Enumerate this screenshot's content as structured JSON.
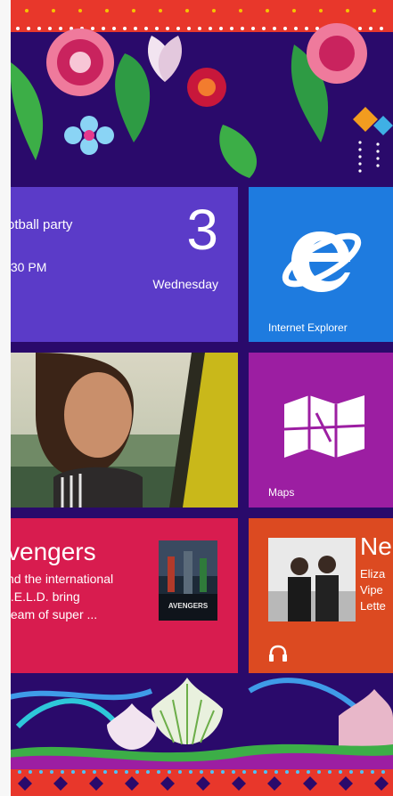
{
  "tiles": {
    "calendar": {
      "event": "otball party",
      "time": ":30 PM",
      "day": "3",
      "weekday": "Wednesday"
    },
    "internet_explorer": {
      "label": "Internet Explorer",
      "icon": "internet-explorer-icon"
    },
    "photos": {
      "icon": "photo"
    },
    "maps": {
      "label": "Maps",
      "icon": "maps-icon"
    },
    "video": {
      "title": "vengers",
      "lines": [
        "nd the international",
        "I.E.L.D. bring",
        "team of super ..."
      ],
      "poster_text": "AVENGERS"
    },
    "music": {
      "title": "Ne",
      "lines": [
        "Eliza",
        "Vipe",
        "Lette"
      ],
      "icon": "headphones-icon"
    }
  },
  "colors": {
    "background": "#2a0a6b",
    "calendar": "#5b3bc8",
    "internet_explorer": "#1e7bdf",
    "maps": "#9c1ea2",
    "video": "#d81c4f",
    "music": "#dc4a21"
  }
}
